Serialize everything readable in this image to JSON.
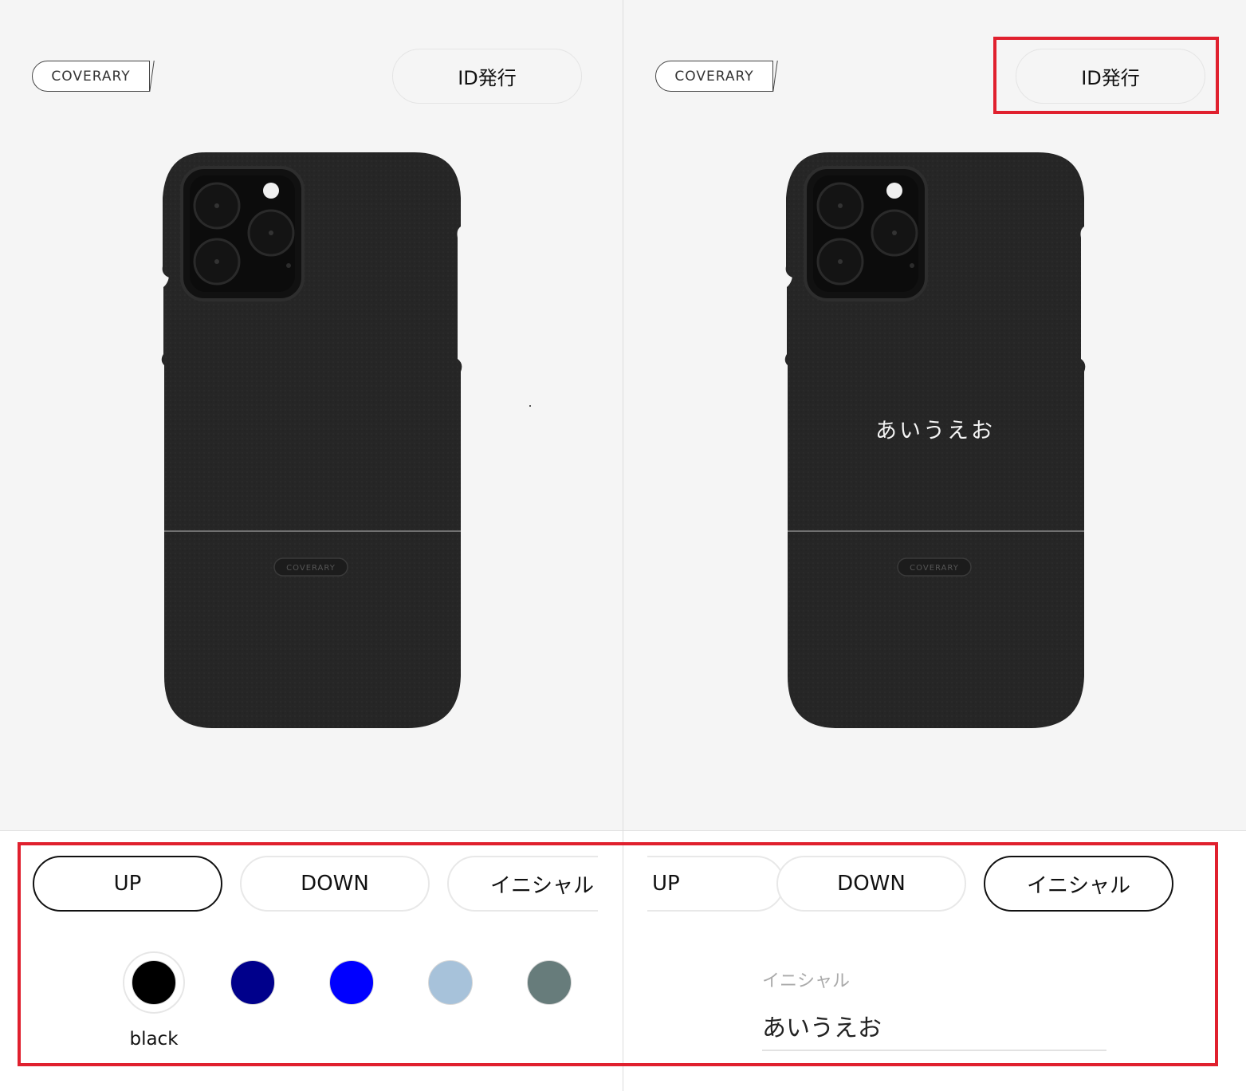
{
  "brand": {
    "logo_text": "COVERARY",
    "case_emblem_text": "COVERARY"
  },
  "header": {
    "id_button_label": "ID発行"
  },
  "tabs": [
    {
      "label": "UP"
    },
    {
      "label": "DOWN"
    },
    {
      "label": "イニシャル"
    }
  ],
  "left_panel": {
    "active_tab": "UP",
    "swatches": [
      {
        "name": "black",
        "color": "#000000",
        "selected": true
      },
      {
        "name": "navy",
        "color": "#00008b"
      },
      {
        "name": "blue",
        "color": "#0000ff"
      },
      {
        "name": "light-blue",
        "color": "#a7c2da"
      },
      {
        "name": "gray-green",
        "color": "#677c7b"
      }
    ],
    "selected_swatch_label": "black"
  },
  "right_panel": {
    "active_tab": "イニシャル",
    "initial_field": {
      "label": "イニシャル",
      "value": "あいうえお"
    },
    "case_initial_text": "あいうえお"
  },
  "colors": {
    "highlight": "#e0202e",
    "case_body": "#262626",
    "preview_bg": "#f5f5f5"
  }
}
